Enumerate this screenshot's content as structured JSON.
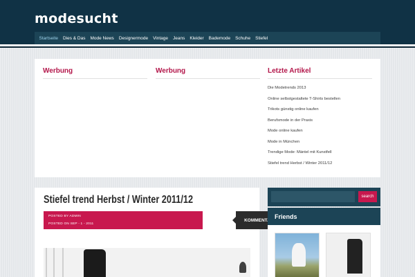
{
  "site": {
    "title": "modesucht"
  },
  "nav": {
    "items": [
      {
        "label": "Startseite",
        "active": true
      },
      {
        "label": "Dies & Das"
      },
      {
        "label": "Mode News"
      },
      {
        "label": "Designermode"
      },
      {
        "label": "Vintage"
      },
      {
        "label": "Jeans"
      },
      {
        "label": "Kleider"
      },
      {
        "label": "Bademode"
      },
      {
        "label": "Schuhe"
      },
      {
        "label": "Stiefel"
      }
    ]
  },
  "widgets": {
    "ad1": {
      "title": "Werbung"
    },
    "ad2": {
      "title": "Werbung"
    },
    "latest": {
      "title": "Letzte Artikel",
      "items": [
        "Die Modetrends 2013",
        "Online selbstgestaltete T-Shirts bestellen",
        "Trikots günstig online kaufen",
        "Berufsmode in der Praxis",
        "Mode online kaufen",
        "Mode in München",
        "Trendige Mode: Mäntel mit Kunstfell",
        "Stiefel trend Herbst / Winter 2011/12"
      ]
    }
  },
  "post": {
    "title": "Stiefel trend Herbst / Winter 2011/12",
    "author_line": "POSTED BY ADMIN",
    "date_line": "POSTED ON SEP - 1 - 2011",
    "comments_label": "KOMMENTARE"
  },
  "sidebar": {
    "search_label": "search",
    "friends_title": "Friends"
  },
  "colors": {
    "header_bg": "#103245",
    "nav_bg": "#1c4456",
    "accent": "#c8184e",
    "widget_title": "#b3164a"
  }
}
